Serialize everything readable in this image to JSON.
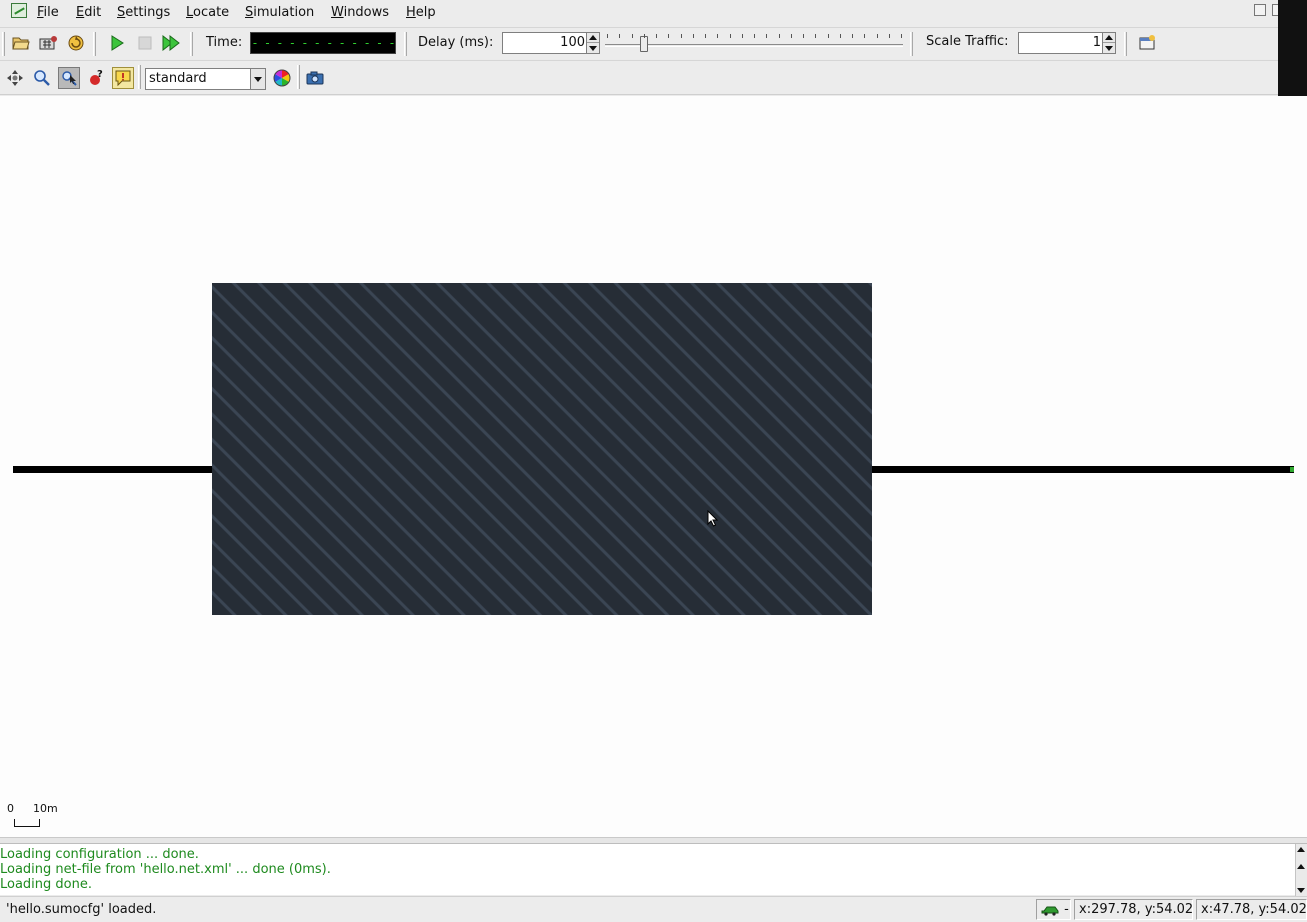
{
  "menu": {
    "items": [
      "File",
      "Edit",
      "Settings",
      "Locate",
      "Simulation",
      "Windows",
      "Help"
    ]
  },
  "toolbar1": {
    "buttons": [
      "open-config",
      "open-network",
      "reload",
      "run",
      "stop",
      "step"
    ],
    "time_label": "Time:",
    "time_value": "- - - - - - - - - - - - - - - - -",
    "delay_label": "Delay (ms):",
    "delay_value": "100",
    "delay_slider_fraction": 0.12,
    "scale_traffic_label": "Scale Traffic:",
    "scale_traffic_value": "1"
  },
  "toolbar2": {
    "buttons": [
      "recenter-view",
      "zoom",
      "locate-junction",
      "show-in-breakpoint",
      "tooltips"
    ],
    "scheme_selected": "standard"
  },
  "canvas": {
    "scale_zero": "0",
    "scale_length": "10m",
    "polygon_color": "#262d36",
    "road_color": "#000000"
  },
  "log": {
    "lines": [
      "Loading configuration ... done.",
      "Loading net-file from 'hello.net.xml' ... done (0ms).",
      "Loading done."
    ],
    "color": "#1e8a1e"
  },
  "status": {
    "message": "'hello.sumocfg' loaded.",
    "vehicle_indicator": "-",
    "coords_net": "x:297.78, y:54.02",
    "coords_geo": "x:47.78, y:54.02"
  }
}
